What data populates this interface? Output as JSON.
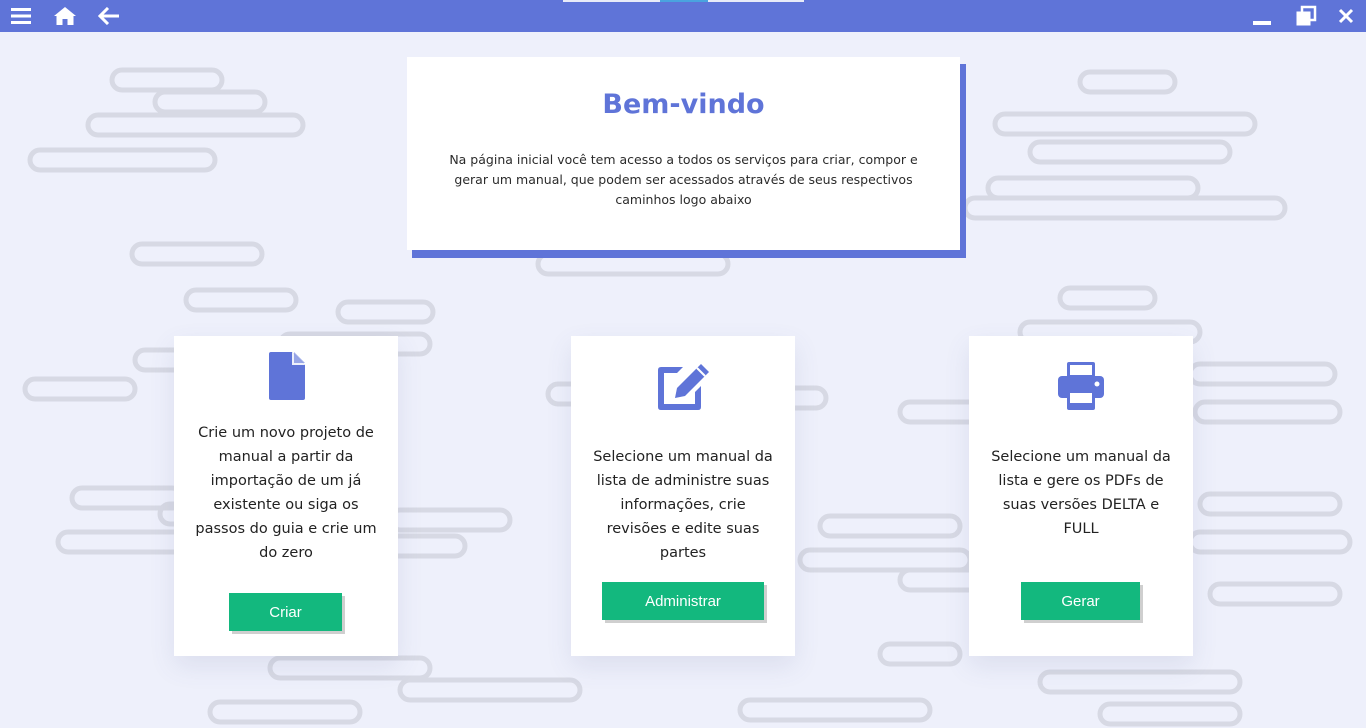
{
  "titlebar": {
    "menu_icon": "hamburger-menu-icon",
    "home_icon": "home-icon",
    "back_icon": "arrow-left-icon",
    "minimize_icon": "minimize-icon",
    "restore_icon": "restore-window-icon",
    "close_icon": "close-icon",
    "background_color": "#5f74d8"
  },
  "welcome": {
    "title": "Bem-vindo",
    "description": "Na página inicial você tem acesso a todos os serviços para criar, compor e gerar um manual, que podem ser acessados através de seus respectivos caminhos logo abaixo"
  },
  "cards": [
    {
      "icon": "file-icon",
      "description": "Crie um novo projeto de manual a partir da importação de um já existente ou siga os passos do guia e crie um do zero",
      "button_label": "Criar"
    },
    {
      "icon": "edit-icon",
      "description": "Selecione um manual da lista de administre suas informações, crie revisões e edite suas partes",
      "button_label": "Administrar"
    },
    {
      "icon": "printer-icon",
      "description": "Selecione um manual da lista e gere os PDFs de suas versões DELTA e FULL",
      "button_label": "Gerar"
    }
  ],
  "colors": {
    "accent": "#5f74d8",
    "button": "#13b87e",
    "background": "#eef0fb"
  }
}
